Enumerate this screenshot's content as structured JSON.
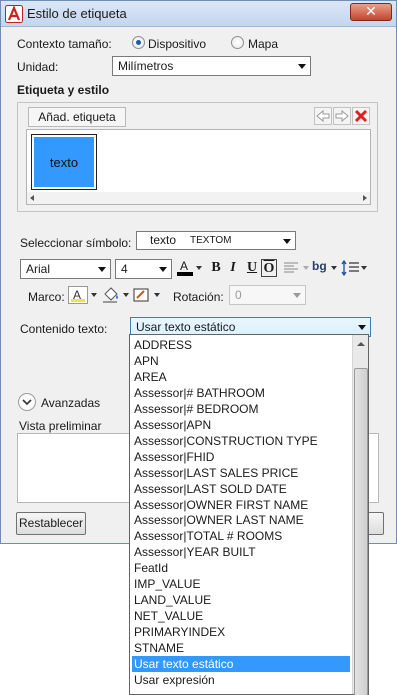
{
  "window": {
    "title": "Estilo de etiqueta",
    "close_label": "✕"
  },
  "size_context": {
    "label": "Contexto tamaño:",
    "option_device": "Dispositivo",
    "option_map": "Mapa",
    "selected": "Dispositivo"
  },
  "units": {
    "label": "Unidad:",
    "value": "Milímetros"
  },
  "label_style": {
    "title": "Etiqueta y estilo",
    "add_label": "Añad. etiqueta",
    "items": [
      {
        "text": "texto"
      }
    ]
  },
  "symbol": {
    "label": "Seleccionar símbolo:",
    "preview": "texto",
    "value": "TEXTOM"
  },
  "text_format": {
    "font": "Arial",
    "size": "4",
    "bold": "B",
    "italic": "I",
    "underline": "U",
    "overline": "O",
    "bg_label": "bg",
    "color_label": "A"
  },
  "frame": {
    "label": "Marco:",
    "rotation_label": "Rotación:",
    "rotation_value": "0"
  },
  "content": {
    "label": "Contenido texto:",
    "value": "Usar texto estático",
    "options": [
      "ADDRESS",
      "APN",
      "AREA",
      "Assessor|# BATHROOM",
      "Assessor|# BEDROOM",
      "Assessor|APN",
      "Assessor|CONSTRUCTION TYPE",
      "Assessor|FHID",
      "Assessor|LAST SALES PRICE",
      "Assessor|LAST SOLD DATE",
      "Assessor|OWNER FIRST NAME",
      "Assessor|OWNER LAST NAME",
      "Assessor|TOTAL # ROOMS",
      "Assessor|YEAR BUILT",
      "FeatId",
      "IMP_VALUE",
      "LAND_VALUE",
      "NET_VALUE",
      "PRIMARYINDEX",
      "STNAME",
      "Usar texto estático",
      "Usar expresión"
    ],
    "selected": "Usar texto estático"
  },
  "advanced": {
    "label": "Avanzadas"
  },
  "preview": {
    "label": "Vista preliminar"
  },
  "buttons": {
    "reset": "Restablecer"
  },
  "colors": {
    "accent": "#3399ff",
    "close": "#c6452b",
    "delete": "#e02020"
  }
}
